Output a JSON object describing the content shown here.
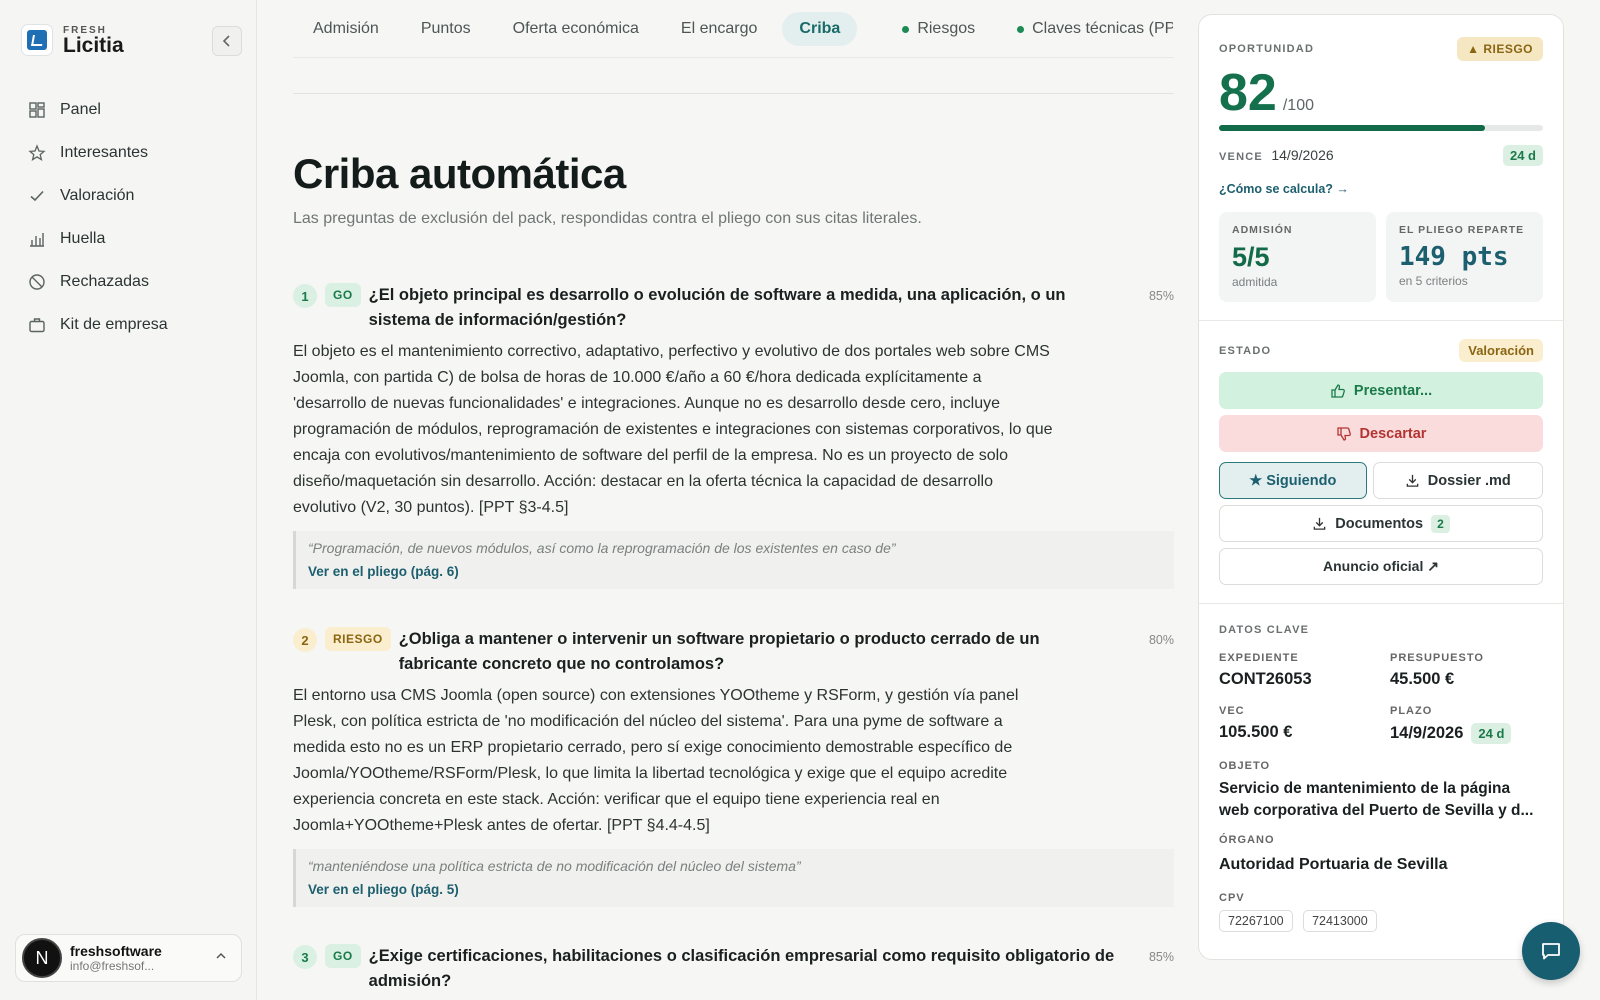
{
  "brand": {
    "top": "FRESH",
    "name": "Licitia"
  },
  "nav": [
    {
      "label": "Panel",
      "icon": "dashboard-icon"
    },
    {
      "label": "Interesantes",
      "icon": "star-icon"
    },
    {
      "label": "Valoración",
      "icon": "check-icon"
    },
    {
      "label": "Huella",
      "icon": "bar-chart-icon"
    },
    {
      "label": "Rechazadas",
      "icon": "ban-icon"
    },
    {
      "label": "Kit de empresa",
      "icon": "briefcase-icon"
    }
  ],
  "user": {
    "initial": "N",
    "name": "freshsoftware",
    "email": "info@freshsof..."
  },
  "tabs": [
    {
      "label": "Admisión"
    },
    {
      "label": "Puntos"
    },
    {
      "label": "Oferta económica"
    },
    {
      "label": "El encargo"
    },
    {
      "label": "Criba",
      "active": true
    },
    {
      "label": "Riesgos",
      "dot": true
    },
    {
      "label": "Claves técnicas (PPT",
      "dot": true
    }
  ],
  "page": {
    "title": "Criba automática",
    "subtitle": "Las preguntas de exclusión del pack, respondidas contra el pliego con sus citas literales."
  },
  "questions": [
    {
      "num": "1",
      "verdict": "GO",
      "title": "¿El objeto principal es desarrollo o evolución de software a medida, una aplicación, o un sistema de información/gestión?",
      "confidence": "85%",
      "body": "El objeto es el mantenimiento correctivo, adaptativo, perfectivo y evolutivo de dos portales web sobre CMS Joomla, con partida C) de bolsa de horas de 10.000 €/año a 60 €/hora dedicada explícitamente a 'desarrollo de nuevas funcionalidades' e integraciones. Aunque no es desarrollo desde cero, incluye programación de módulos, reprogramación de existentes e integraciones con sistemas corporativos, lo que encaja con evolutivos/mantenimiento de software del perfil de la empresa. No es un proyecto de solo diseño/maquetación sin desarrollo. Acción: destacar en la oferta técnica la capacidad de desarrollo evolutivo (V2, 30 puntos). [PPT §3-4.5]",
      "quote": "“Programación, de nuevos módulos, así como la reprogramación de los existentes en caso de”",
      "link": "Ver en el pliego (pág. 6)"
    },
    {
      "num": "2",
      "verdict": "RIESGO",
      "title": "¿Obliga a mantener o intervenir un software propietario o producto cerrado de un fabricante concreto que no controlamos?",
      "confidence": "80%",
      "body": "El entorno usa CMS Joomla (open source) con extensiones YOOtheme y RSForm, y gestión vía panel Plesk, con política estricta de 'no modificación del núcleo del sistema'. Para una pyme de software a medida esto no es un ERP propietario cerrado, pero sí exige conocimiento demostrable específico de Joomla/YOOtheme/RSForm/Plesk, lo que limita la libertad tecnológica y exige que el equipo acredite experiencia concreta en este stack. Acción: verificar que el equipo tiene experiencia real en Joomla+YOOtheme+Plesk antes de ofertar. [PPT §4.4-4.5]",
      "quote": "“manteniéndose una política estricta de no modificación del núcleo del sistema”",
      "link": "Ver en el pliego (pág. 5)"
    },
    {
      "num": "3",
      "verdict": "GO",
      "title": "¿Exige certificaciones, habilitaciones o clasificación empresarial como requisito obligatorio de admisión?",
      "confidence": "85%"
    }
  ],
  "panel": {
    "opportunity_label": "OPORTUNIDAD",
    "risk_badge": "▲ RIESGO",
    "score": "82",
    "score_max": "/100",
    "score_fraction": 0.82,
    "due_label": "VENCE",
    "due_date": "14/9/2026",
    "due_days": "24 d",
    "how_link": "¿Cómo se calcula? →",
    "admission_label": "ADMISIÓN",
    "admission_value": "5/5",
    "admission_note": "admitida",
    "points_label": "EL PLIEGO REPARTE",
    "points_value": "149 pts",
    "points_note": "en 5 criterios",
    "state_label": "ESTADO",
    "state_value": "Valoración",
    "present_btn": "Presentar...",
    "discard_btn": "Descartar",
    "follow_btn": "★ Siguiendo",
    "dossier_btn": "Dossier .md",
    "docs_btn": "Documentos",
    "docs_count": "2",
    "official_btn": "Anuncio oficial ↗",
    "key_data_label": "DATOS CLAVE",
    "expediente_label": "EXPEDIENTE",
    "expediente": "CONT26053",
    "budget_label": "PRESUPUESTO",
    "budget": "45.500 €",
    "vec_label": "VEC",
    "vec": "105.500 €",
    "term_label": "PLAZO",
    "term": "14/9/2026",
    "term_days": "24 d",
    "object_label": "OBJETO",
    "object": "Servicio de mantenimiento de la página web corporativa del Puerto de Sevilla y d...",
    "organ_label": "ÓRGANO",
    "organ": "Autoridad Portuaria de Sevilla",
    "cpv_label": "CPV",
    "cpv": [
      "72267100",
      "72413000"
    ]
  }
}
